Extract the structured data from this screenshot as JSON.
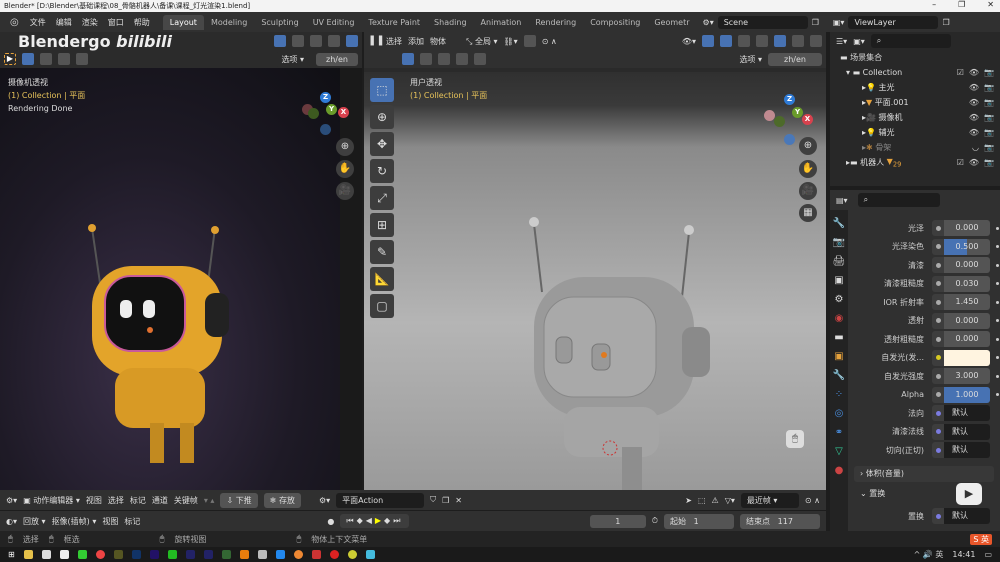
{
  "title": "Blender* [D:\\Blender\\基础课程\\08_骨骼机器人\\备课\\课程_灯光渲染1.blend]",
  "watermark": "Blendergo bilibili",
  "menu": [
    "文件",
    "编辑",
    "渲染",
    "窗口",
    "帮助"
  ],
  "workspaces": [
    "Layout",
    "Modeling",
    "Sculpting",
    "UV Editing",
    "Texture Paint",
    "Shading",
    "Animation",
    "Rendering",
    "Compositing",
    "Geometr"
  ],
  "scene": "Scene",
  "viewlayer": "ViewLayer",
  "left_viewport": {
    "options": "选项",
    "lang": "zh/en",
    "view_name": "摄像机透视",
    "collection": "(1) Collection | 平面",
    "status": "Rendering Done"
  },
  "right_viewport": {
    "menus": [
      "选择",
      "添加",
      "物体"
    ],
    "transform": "全局",
    "options": "选项",
    "lang": "zh/en",
    "view_name": "用户透视",
    "collection": "(1) Collection | 平面"
  },
  "outliner": {
    "root": "场景集合",
    "items": [
      {
        "name": "Collection",
        "level": 0
      },
      {
        "name": "主光",
        "level": 1
      },
      {
        "name": "平面.001",
        "level": 1
      },
      {
        "name": "摄像机",
        "level": 1
      },
      {
        "name": "辅光",
        "level": 1
      },
      {
        "name": "骨架",
        "level": 1
      },
      {
        "name": "机器人",
        "level": 0,
        "badge": "29"
      }
    ]
  },
  "properties": {
    "rows": [
      {
        "label": "光泽",
        "value": "0.000"
      },
      {
        "label": "光泽染色",
        "value": "0.500",
        "fill": 0.5
      },
      {
        "label": "清漆",
        "value": "0.000"
      },
      {
        "label": "清漆粗糙度",
        "value": "0.030"
      },
      {
        "label": "IOR 折射率",
        "value": "1.450"
      },
      {
        "label": "透射",
        "value": "0.000"
      },
      {
        "label": "透射粗糙度",
        "value": "0.000"
      },
      {
        "label": "自发光(发...",
        "value": "",
        "color": "#fff4e0"
      },
      {
        "label": "自发光强度",
        "value": "3.000"
      },
      {
        "label": "Alpha",
        "value": "1.000",
        "fill": 1.0
      },
      {
        "label": "法向",
        "value": "默认"
      },
      {
        "label": "清漆法线",
        "value": "默认"
      },
      {
        "label": "切向(正切)",
        "value": "默认"
      }
    ],
    "panel_volume": "体积(音量)",
    "panel_displace": "置换",
    "displace_label": "置换",
    "displace_value": "默认"
  },
  "dopesheet": {
    "mode": "动作编辑器",
    "menus": [
      "视图",
      "选择",
      "标记",
      "通道",
      "关键帧"
    ],
    "push": "下推",
    "stash": "存放",
    "action": "平面Action",
    "snap": "最近帧"
  },
  "timeline": {
    "playback": "回放",
    "keying": "抠像(插帧)",
    "menus": [
      "视图",
      "标记"
    ],
    "frame": "1",
    "start_label": "起始",
    "start": "1",
    "end_label": "结束点",
    "end": "117"
  },
  "status": {
    "select": "选择",
    "box": "框选",
    "rotate": "旋转视图",
    "context": "物体上下文菜单"
  },
  "taskbar": {
    "ime": "英",
    "time": "14:41"
  }
}
